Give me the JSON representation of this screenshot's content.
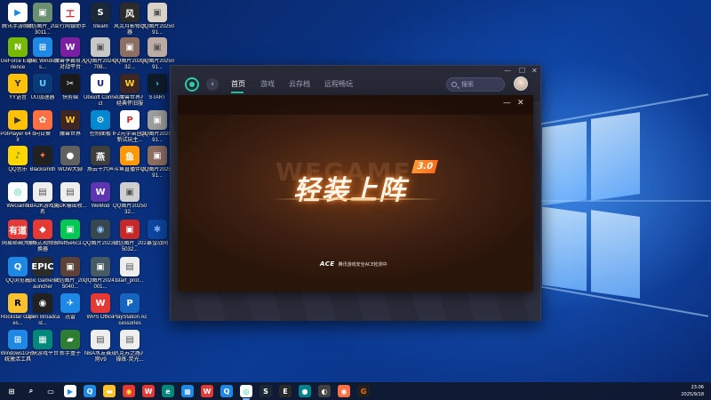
{
  "desktop": {
    "icons": [
      {
        "label": "腾讯手游助手",
        "icon": "tencent-gamebox-icon",
        "color": "#ffffff",
        "text": "▶",
        "fg": "#1e88e5"
      },
      {
        "label": "微信图片_2023011...",
        "icon": "image-icon",
        "color": "#6b8f71",
        "text": "▣",
        "fg": "#fff"
      },
      {
        "label": "工行网银助手",
        "icon": "icbc-icon",
        "color": "#ffffff",
        "text": "工",
        "fg": "#d32f2f"
      },
      {
        "label": "Steam",
        "icon": "steam-icon",
        "color": "#1b2838",
        "text": "S",
        "fg": "#fff"
      },
      {
        "label": "风灵月影修改器",
        "icon": "trainer-icon",
        "color": "#2b2b2b",
        "text": "风",
        "fg": "#fff"
      },
      {
        "label": "QQ图片2025091...",
        "icon": "image-icon",
        "color": "#d9d2c8",
        "text": "▣",
        "fg": "#555"
      },
      {
        "label": "GeForce Experience",
        "icon": "nvidia-icon",
        "color": "#76b900",
        "text": "N",
        "fg": "#fff"
      },
      {
        "label": "微软 Windows...",
        "icon": "windows-icon",
        "color": "#1e88e5",
        "text": "⊞",
        "fg": "#fff"
      },
      {
        "label": "魔兽争霸官方对战平台",
        "icon": "warcraft-platform-icon",
        "color": "#7b1fa2",
        "text": "W",
        "fg": "#fff"
      },
      {
        "label": "QQ图片20240708...",
        "icon": "image-icon",
        "color": "#c8c8c8",
        "text": "▣",
        "fg": "#555"
      },
      {
        "label": "QQ图片2025032...",
        "icon": "image-icon",
        "color": "#8d6e63",
        "text": "▣",
        "fg": "#fff"
      },
      {
        "label": "QQ图片2025091...",
        "icon": "image-icon",
        "color": "#bcaaa4",
        "text": "▣",
        "fg": "#555"
      },
      {
        "label": "YY语音",
        "icon": "yy-icon",
        "color": "#ffc107",
        "text": "Y",
        "fg": "#333"
      },
      {
        "label": "UU加速器",
        "icon": "uu-icon",
        "color": "#0a3a7a",
        "text": "U",
        "fg": "#5ad1ff"
      },
      {
        "label": "快剪辑",
        "icon": "kuaijianji-icon",
        "color": "#1a1a1a",
        "text": "✂",
        "fg": "#fff"
      },
      {
        "label": "Ubisoft Connect",
        "icon": "ubisoft-icon",
        "color": "#ffffff",
        "text": "U",
        "fg": "#1a237e"
      },
      {
        "label": "《魔兽世界》经典怀旧服",
        "icon": "wow-classic-icon",
        "color": "#3e2723",
        "text": "W",
        "fg": "#ffca28"
      },
      {
        "label": "START",
        "icon": "start-icon",
        "color": "#0d1b2a",
        "text": "›",
        "fg": "#4dd0e1"
      },
      {
        "label": "PotPlayer 64 bit",
        "icon": "potplayer-icon",
        "color": "#ffc107",
        "text": "▶",
        "fg": "#333"
      },
      {
        "label": "向日葵",
        "icon": "sunflower-icon",
        "color": "#ff7043",
        "text": "✿",
        "fg": "#fff"
      },
      {
        "label": "魔兽世界",
        "icon": "wow-icon",
        "color": "#3e2723",
        "text": "W",
        "fg": "#ffca28"
      },
      {
        "label": "控制面板",
        "icon": "control-panel-icon",
        "color": "#0288d1",
        "text": "⚙",
        "fg": "#fff"
      },
      {
        "label": "IFZ元宇宙区域新试玩主...",
        "icon": "pdf-icon",
        "color": "#ffffff",
        "text": "P",
        "fg": "#d32f2f"
      },
      {
        "label": "QQ图片2025091...",
        "icon": "image-icon",
        "color": "#9e9e9e",
        "text": "▣",
        "fg": "#fff"
      },
      {
        "label": "QQ音乐",
        "icon": "qqmusic-icon",
        "color": "#ffd600",
        "text": "♪",
        "fg": "#2e7d32"
      },
      {
        "label": "Blacksmith",
        "icon": "blacksmith-icon",
        "color": "#212121",
        "text": "✦",
        "fg": "#ff7043"
      },
      {
        "label": "WOW大脚",
        "icon": "bigfoot-icon",
        "color": "#616161",
        "text": "●",
        "fg": "#fff"
      },
      {
        "label": "燕云十六声",
        "icon": "yanyun-icon",
        "color": "#3e3e3e",
        "text": "燕",
        "fg": "#fff"
      },
      {
        "label": "斗鱼直播伴侣",
        "icon": "douyu-icon",
        "color": "#ff9800",
        "text": "鱼",
        "fg": "#fff"
      },
      {
        "label": "QQ图片2025091...",
        "icon": "image-icon",
        "color": "#8d6e63",
        "text": "▣",
        "fg": "#fff"
      },
      {
        "label": "WeGame",
        "icon": "wegame-icon",
        "color": "#ffffff",
        "text": "◎",
        "fg": "#2ad0a8"
      },
      {
        "label": "NBA2K游戏报名",
        "icon": "document-icon",
        "color": "#eeeeee",
        "text": "▤",
        "fg": "#555"
      },
      {
        "label": "英DK输出收...",
        "icon": "document-icon",
        "color": "#eeeeee",
        "text": "▤",
        "fg": "#555"
      },
      {
        "label": "WeMod",
        "icon": "wemod-icon",
        "color": "#5e35b1",
        "text": "W",
        "fg": "#fff"
      },
      {
        "label": "QQ图片2025032...",
        "icon": "image-icon",
        "color": "#cfcfcf",
        "text": "▣",
        "fg": "#555"
      },
      {
        "label": "",
        "icon": "blank-slot",
        "color": "transparent",
        "text": "",
        "fg": "#fff"
      },
      {
        "label": "网易邮箱大师",
        "icon": "netease-mail-icon",
        "color": "#e53935",
        "text": "有道",
        "fg": "#fff"
      },
      {
        "label": "嗨格式视频转换器",
        "icon": "converter-icon",
        "color": "#e53935",
        "text": "◆",
        "fg": "#fff"
      },
      {
        "label": "5ffeff5e6c3...",
        "icon": "image-icon",
        "color": "#00c853",
        "text": "▣",
        "fg": "#fff"
      },
      {
        "label": "QQ图片2023...",
        "icon": "image-icon",
        "color": "#37474f",
        "text": "◉",
        "fg": "#90caf9"
      },
      {
        "label": "微信图片_2025032...",
        "icon": "image-icon",
        "color": "#c62828",
        "text": "▣",
        "fg": "#fff"
      },
      {
        "label": "暴雪战网",
        "icon": "battlenet-icon",
        "color": "#0d47a1",
        "text": "✱",
        "fg": "#82b1ff"
      },
      {
        "label": "QQ浏览器",
        "icon": "qqbrowser-icon",
        "color": "#1e88e5",
        "text": "Q",
        "fg": "#fff"
      },
      {
        "label": "Epic Games Launcher",
        "icon": "epic-icon",
        "color": "#2b2b2b",
        "text": "EPIC",
        "fg": "#fff"
      },
      {
        "label": "微信图片_2025040...",
        "icon": "image-icon",
        "color": "#5d4037",
        "text": "▣",
        "fg": "#fff"
      },
      {
        "label": "QQ图片20241001...",
        "icon": "image-icon",
        "color": "#455a64",
        "text": "▣",
        "fg": "#fff"
      },
      {
        "label": "start_prot...",
        "icon": "file-icon",
        "color": "#eeeeee",
        "text": "▤",
        "fg": "#555"
      },
      {
        "label": "",
        "icon": "blank-slot",
        "color": "transparent",
        "text": "",
        "fg": "#fff"
      },
      {
        "label": "Rockstar Games...",
        "icon": "rockstar-icon",
        "color": "#fbc02d",
        "text": "R",
        "fg": "#000"
      },
      {
        "label": "Open Broadcast...",
        "icon": "obs-icon",
        "color": "#212121",
        "text": "◉",
        "fg": "#fff"
      },
      {
        "label": "迅雷",
        "icon": "xunlei-icon",
        "color": "#1e88e5",
        "text": "✈",
        "fg": "#fff"
      },
      {
        "label": "WPS Office",
        "icon": "wps-icon",
        "color": "#e53935",
        "text": "W",
        "fg": "#fff"
      },
      {
        "label": "PlayStation Accessories",
        "icon": "playstation-icon",
        "color": "#1565c0",
        "text": "P",
        "fg": "#fff"
      },
      {
        "label": "",
        "icon": "blank-slot",
        "color": "transparent",
        "text": "",
        "fg": "#fff"
      },
      {
        "label": "Windows10 系统激活工具",
        "icon": "windows10-tool-icon",
        "color": "#1e88e5",
        "text": "⊞",
        "fg": "#fff"
      },
      {
        "label": "方块游戏平台",
        "icon": "fangkuai-icon",
        "color": "#00897b",
        "text": "▦",
        "fg": "#fff"
      },
      {
        "label": "新手盒子",
        "icon": "newbie-box-icon",
        "color": "#2e7d32",
        "text": "▰",
        "fg": "#fff"
      },
      {
        "label": "NBA水友赛规则V9",
        "icon": "document-icon",
        "color": "#eeeeee",
        "text": "▤",
        "fg": "#555"
      },
      {
        "label": "《克苏之路》操练·荧光...",
        "icon": "document-icon",
        "color": "#eeeeee",
        "text": "▤",
        "fg": "#555"
      },
      {
        "label": "",
        "icon": "blank-slot",
        "color": "transparent",
        "text": "",
        "fg": "#fff"
      }
    ]
  },
  "app": {
    "tabs": [
      "首页",
      "游戏",
      "云存档",
      "远程畅玩"
    ],
    "active_tab": 0,
    "search_placeholder": "搜索",
    "window_controls": {
      "minimize": "—",
      "maximize": "☐",
      "close": "✕"
    },
    "accent": "#2ad0a8"
  },
  "popup": {
    "brand": "WEGAME",
    "version": "3.0",
    "headline": "轻装上阵",
    "ace_logo": "ACE",
    "ace_text": "腾讯游戏安全ACE检测中",
    "minimize": "—",
    "close": "✕"
  },
  "taskbar": {
    "items": [
      {
        "icon": "start-windows-icon",
        "color": "transparent",
        "text": "⊞",
        "fg": "#fff"
      },
      {
        "icon": "search-icon",
        "color": "transparent",
        "text": "⌕",
        "fg": "#fff"
      },
      {
        "icon": "task-view-icon",
        "color": "transparent",
        "text": "▭",
        "fg": "#fff"
      },
      {
        "icon": "tencent-gamebox-icon",
        "color": "#ffffff",
        "text": "▶",
        "fg": "#1e88e5"
      },
      {
        "icon": "qqbrowser-icon",
        "color": "#1e88e5",
        "text": "Q",
        "fg": "#fff"
      },
      {
        "icon": "file-explorer-icon",
        "color": "#fbc02d",
        "text": "▬",
        "fg": "#fff"
      },
      {
        "icon": "chrome-icon",
        "color": "#e53935",
        "text": "◉",
        "fg": "#ffeb3b"
      },
      {
        "icon": "wps-icon",
        "color": "#e53935",
        "text": "W",
        "fg": "#fff"
      },
      {
        "icon": "edge-icon",
        "color": "#00897b",
        "text": "e",
        "fg": "#fff"
      },
      {
        "icon": "ms-store-icon",
        "color": "#1e88e5",
        "text": "▦",
        "fg": "#fff"
      },
      {
        "icon": "wps-icon",
        "color": "#e53935",
        "text": "W",
        "fg": "#fff"
      },
      {
        "icon": "qqbrowser-icon",
        "color": "#1e88e5",
        "text": "Q",
        "fg": "#fff"
      },
      {
        "icon": "wegame-icon",
        "color": "#ffffff",
        "text": "◎",
        "fg": "#2ad0a8"
      },
      {
        "icon": "steam-icon",
        "color": "#1b2838",
        "text": "S",
        "fg": "#fff"
      },
      {
        "icon": "epic-icon",
        "color": "#2b2b2b",
        "text": "E",
        "fg": "#fff"
      },
      {
        "icon": "teal-app-icon",
        "color": "#00838f",
        "text": "●",
        "fg": "#fff"
      },
      {
        "icon": "game-pad-icon",
        "color": "#424242",
        "text": "◐",
        "fg": "#fff"
      },
      {
        "icon": "firefox-icon",
        "color": "#ff7043",
        "text": "◉",
        "fg": "#fff"
      },
      {
        "icon": "flag-icon",
        "color": "#212121",
        "text": "G",
        "fg": "#ff6d00"
      }
    ],
    "active_index": 12,
    "time": "23:06",
    "date": "2025/9/18"
  }
}
